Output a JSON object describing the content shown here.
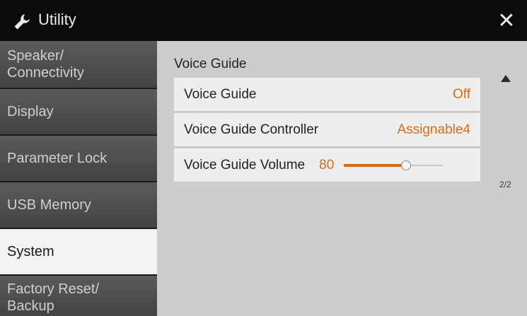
{
  "titlebar": {
    "icon": "wrench-icon",
    "title": "Utility",
    "close_icon": "close-icon",
    "close_glyph": "✕"
  },
  "sidebar": {
    "items": [
      {
        "label": "Speaker/\nConnectivity",
        "active": false
      },
      {
        "label": "Display",
        "active": false
      },
      {
        "label": "Parameter Lock",
        "active": false
      },
      {
        "label": "USB Memory",
        "active": false
      },
      {
        "label": "System",
        "active": true
      },
      {
        "label": "Factory Reset/\nBackup",
        "active": false
      }
    ]
  },
  "main": {
    "section_title": "Voice Guide",
    "rows": [
      {
        "label": "Voice Guide",
        "value": "Off"
      },
      {
        "label": "Voice Guide Controller",
        "value": "Assignable4"
      },
      {
        "label": "Voice Guide Volume",
        "value": "80"
      }
    ],
    "volume_slider_fraction": 0.63,
    "page_indicator": "2/2",
    "scroll_up_icon": "triangle-up-icon"
  },
  "colors": {
    "accent": "#d86a14",
    "panel_bg": "#cdcdcd",
    "row_bg": "#eeeeee",
    "sidebar_item": "#4f4f4f",
    "sidebar_active": "#f3f3f3",
    "titlebar_bg": "#0b0b0b"
  }
}
